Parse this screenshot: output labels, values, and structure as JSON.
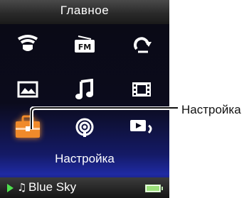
{
  "screen": {
    "title": "Главное",
    "selected_caption": "Настройка"
  },
  "menu": {
    "items": [
      {
        "id": "wireless",
        "icon": "wifi-shield-icon"
      },
      {
        "id": "fm",
        "icon": "fm-radio-icon",
        "badge": "FM"
      },
      {
        "id": "sync",
        "icon": "sync-icon"
      },
      {
        "id": "photo",
        "icon": "photo-icon"
      },
      {
        "id": "music",
        "icon": "music-icon"
      },
      {
        "id": "video",
        "icon": "video-icon"
      },
      {
        "id": "settings",
        "icon": "toolbox-icon",
        "selected": true
      },
      {
        "id": "podcast",
        "icon": "podcast-icon"
      },
      {
        "id": "now-playing",
        "icon": "now-playing-icon"
      }
    ]
  },
  "status": {
    "track": "Blue Sky",
    "play_state": "playing"
  },
  "callout": {
    "label": "Настройка"
  },
  "colors": {
    "accent": "#f08a2a",
    "status_green": "#4fe04f",
    "battery": "#9be07a"
  }
}
